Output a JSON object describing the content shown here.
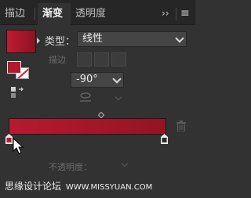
{
  "tabs": [
    {
      "label": "描边"
    },
    {
      "label": "渐变"
    },
    {
      "label": "透明度"
    }
  ],
  "panel_controls": {
    "collapse": "››",
    "menu": "≡"
  },
  "gradient": {
    "type_label": "类型：",
    "type_value": "线性",
    "stroke_label": "描边",
    "angle_value": "-90°",
    "opacity_label": "不透明度：",
    "colors": {
      "start": "#b81930",
      "end": "#941426",
      "accent": "#d0202c"
    }
  },
  "watermark": {
    "text": "思缘设计论坛",
    "url": "WWW.MISSYUAN.COM"
  }
}
